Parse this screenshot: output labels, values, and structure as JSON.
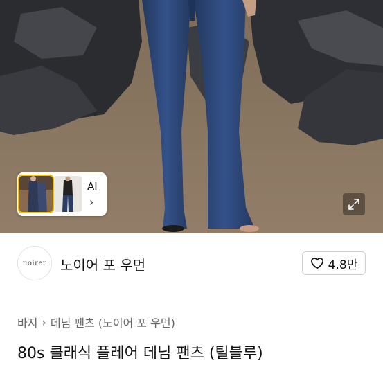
{
  "gallery": {
    "ai_label": "AI",
    "ai_chevron": "›",
    "expand_icon": "expand-icon"
  },
  "seller": {
    "logo_text": "noirer",
    "name": "노이어 포 우먼"
  },
  "like": {
    "icon": "heart-outline-icon",
    "count": "4.8만"
  },
  "breadcrumb": {
    "items": [
      "바지",
      "데님 팬츠 (노이어 포 우먼)"
    ],
    "separator": "›"
  },
  "product": {
    "title": "80s 클래식 플레어 데님 팬츠 (틸블루)"
  },
  "colors": {
    "denim": "#2f4a78",
    "sand": "#8a7762",
    "rock": "#2e2f33",
    "accent_outline": "#f2c200"
  }
}
